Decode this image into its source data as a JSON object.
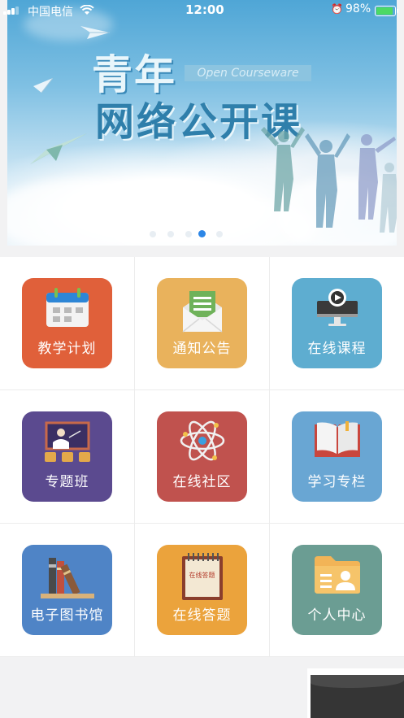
{
  "status_bar": {
    "carrier": "中国电信",
    "time": "12:00",
    "battery": "98%"
  },
  "banner": {
    "title_line1": "青年",
    "title_line2": "网络公开课",
    "subtitle": "Open Courseware",
    "pages": 5,
    "active_page": 4
  },
  "colors": {
    "plan": "#e0603a",
    "notice": "#e9b25c",
    "online_course": "#5eadd0",
    "special_class": "#5b4a8f",
    "community": "#c0524e",
    "study_column": "#69a6d3",
    "library": "#4f84c6",
    "answer": "#eba33c",
    "personal": "#6b9d93",
    "page_indicator_active": "#2d86e6"
  },
  "menu": [
    {
      "label": "教学计划",
      "icon": "calendar-icon"
    },
    {
      "label": "通知公告",
      "icon": "envelope-icon"
    },
    {
      "label": "在线课程",
      "icon": "monitor-play-icon"
    },
    {
      "label": "专题班",
      "icon": "blackboard-teacher-icon"
    },
    {
      "label": "在线社区",
      "icon": "atom-icon"
    },
    {
      "label": "学习专栏",
      "icon": "open-book-icon"
    },
    {
      "label": "电子图书馆",
      "icon": "bookshelf-icon"
    },
    {
      "label": "在线答题",
      "icon": "notepad-icon"
    },
    {
      "label": "个人中心",
      "icon": "profile-folder-icon"
    }
  ],
  "notepad_text": "在线答题"
}
